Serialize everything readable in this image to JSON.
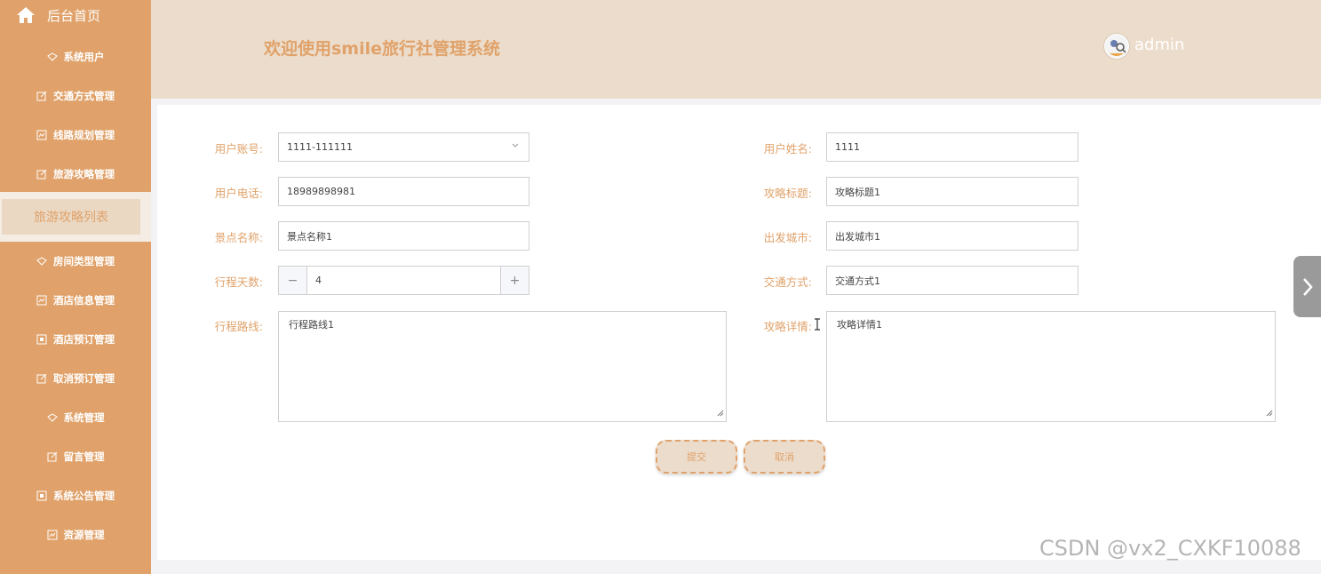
{
  "sidebar": {
    "home_label": "后台首页",
    "items": [
      {
        "label": "系统用户",
        "icon": "diamond-icon"
      },
      {
        "label": "交通方式管理",
        "icon": "edit-icon"
      },
      {
        "label": "线路规划管理",
        "icon": "chart-icon"
      },
      {
        "label": "旅游攻略管理",
        "icon": "edit-icon"
      },
      {
        "label": "旅游攻略列表",
        "active": true
      },
      {
        "label": "房间类型管理",
        "icon": "diamond-icon"
      },
      {
        "label": "酒店信息管理",
        "icon": "chart-icon"
      },
      {
        "label": "酒店预订管理",
        "icon": "box-icon"
      },
      {
        "label": "取消预订管理",
        "icon": "edit-icon"
      },
      {
        "label": "系统管理",
        "icon": "diamond-icon"
      },
      {
        "label": "留言管理",
        "icon": "edit-icon"
      },
      {
        "label": "系统公告管理",
        "icon": "box-icon"
      },
      {
        "label": "资源管理",
        "icon": "chart-icon"
      }
    ]
  },
  "header": {
    "title": "欢迎使用smile旅行社管理系统",
    "username": "admin"
  },
  "form": {
    "user_account": {
      "label": "用户账号:",
      "value": "1111-111111"
    },
    "user_name": {
      "label": "用户姓名:",
      "value": "1111"
    },
    "user_phone": {
      "label": "用户电话:",
      "value": "18989898981"
    },
    "guide_title": {
      "label": "攻略标题:",
      "value": "攻略标题1"
    },
    "scenic_name": {
      "label": "景点名称:",
      "value": "景点名称1"
    },
    "departure_city": {
      "label": "出发城市:",
      "value": "出发城市1"
    },
    "trip_days": {
      "label": "行程天数:",
      "value": "4",
      "minus": "−",
      "plus": "+"
    },
    "transport": {
      "label": "交通方式:",
      "value": "交通方式1"
    },
    "route": {
      "label": "行程路线:",
      "value": "行程路线1"
    },
    "details": {
      "label": "攻略详情:",
      "value": "攻略详情1"
    },
    "submit_label": "提交",
    "cancel_label": "取消"
  },
  "watermark": "CSDN @vx2_CXKF10088",
  "colors": {
    "accent": "#e0a26a",
    "header_bg": "#ecdccb",
    "active_bg": "#ead8c3"
  }
}
